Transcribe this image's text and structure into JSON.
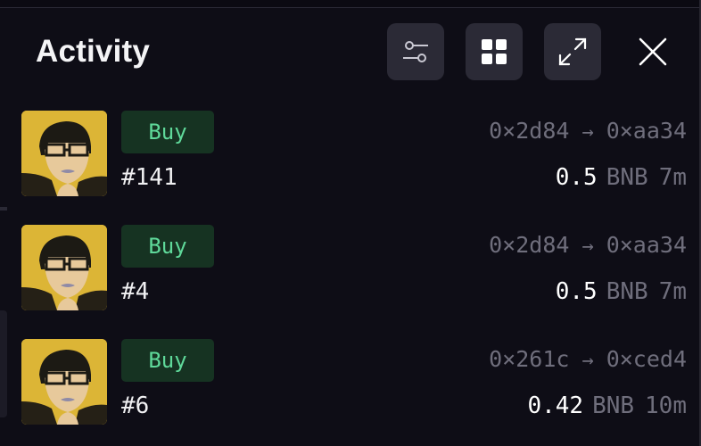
{
  "panel": {
    "title": "Activity"
  },
  "toolbar": {
    "filter_icon": "sliders-icon",
    "grid_icon": "grid-icon",
    "expand_icon": "expand-icon",
    "close_icon": "close-icon"
  },
  "colors": {
    "background": "#0e0d16",
    "button_bg": "#2b2a36",
    "buy_badge_bg": "#163322",
    "buy_badge_text": "#5fd99a",
    "muted_text": "#6f6e7c"
  },
  "activity": [
    {
      "type": "Buy",
      "token": "#141",
      "from": "0×2d84",
      "arrow": "→",
      "to": "0×aa34",
      "amount": "0.5",
      "currency": "BNB",
      "time": "7m"
    },
    {
      "type": "Buy",
      "token": "#4",
      "from": "0×2d84",
      "arrow": "→",
      "to": "0×aa34",
      "amount": "0.5",
      "currency": "BNB",
      "time": "7m"
    },
    {
      "type": "Buy",
      "token": "#6",
      "from": "0×261c",
      "arrow": "→",
      "to": "0×ced4",
      "amount": "0.42",
      "currency": "BNB",
      "time": "10m"
    }
  ]
}
